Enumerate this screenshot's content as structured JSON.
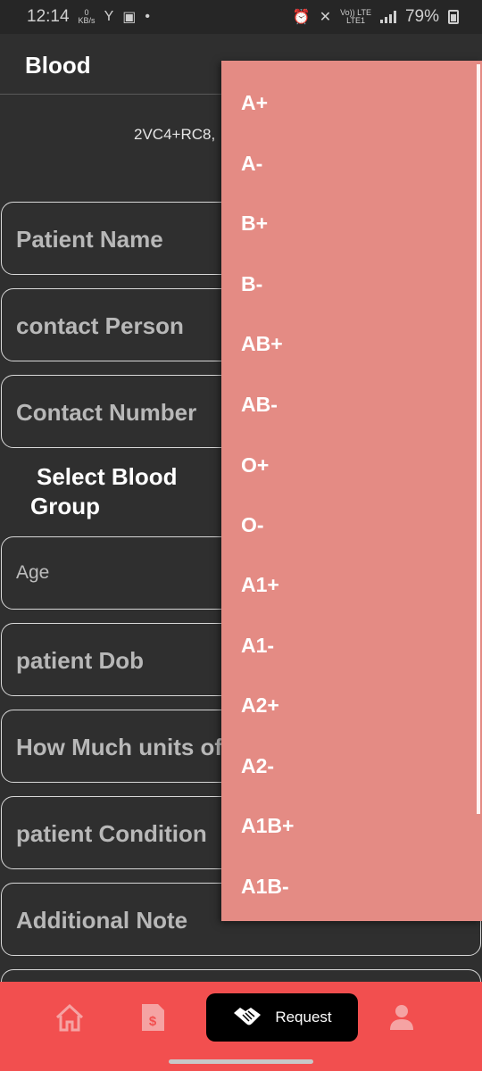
{
  "status_bar": {
    "time": "12:14",
    "data_speed_value": "0",
    "data_speed_unit": "KB/s",
    "network_line1": "Vo)) LTE",
    "network_line2": "LTE1",
    "battery": "79%"
  },
  "header": {
    "title": "Blood"
  },
  "location_text": "2VC4+RC8,",
  "form": {
    "patient_name": "Patient Name",
    "contact_person": "contact Person",
    "contact_number": "Contact Number",
    "blood_group_line1": "Select Blood",
    "blood_group_line2": "Group",
    "age": "Age",
    "patient_dob": "patient Dob",
    "units": "How Much units of",
    "patient_condition": "patient Condition",
    "additional_note": "Additional Note"
  },
  "blood_groups": [
    "A+",
    "A-",
    "B+",
    "B-",
    "AB+",
    "AB-",
    "O+",
    "O-",
    "A1+",
    "A1-",
    "A2+",
    "A2-",
    "A1B+",
    "A1B-"
  ],
  "bottom_nav": {
    "request_label": "Request"
  },
  "colors": {
    "accent": "#f24f4f",
    "dropdown": "#e48b84",
    "background": "#2f2f2f"
  }
}
